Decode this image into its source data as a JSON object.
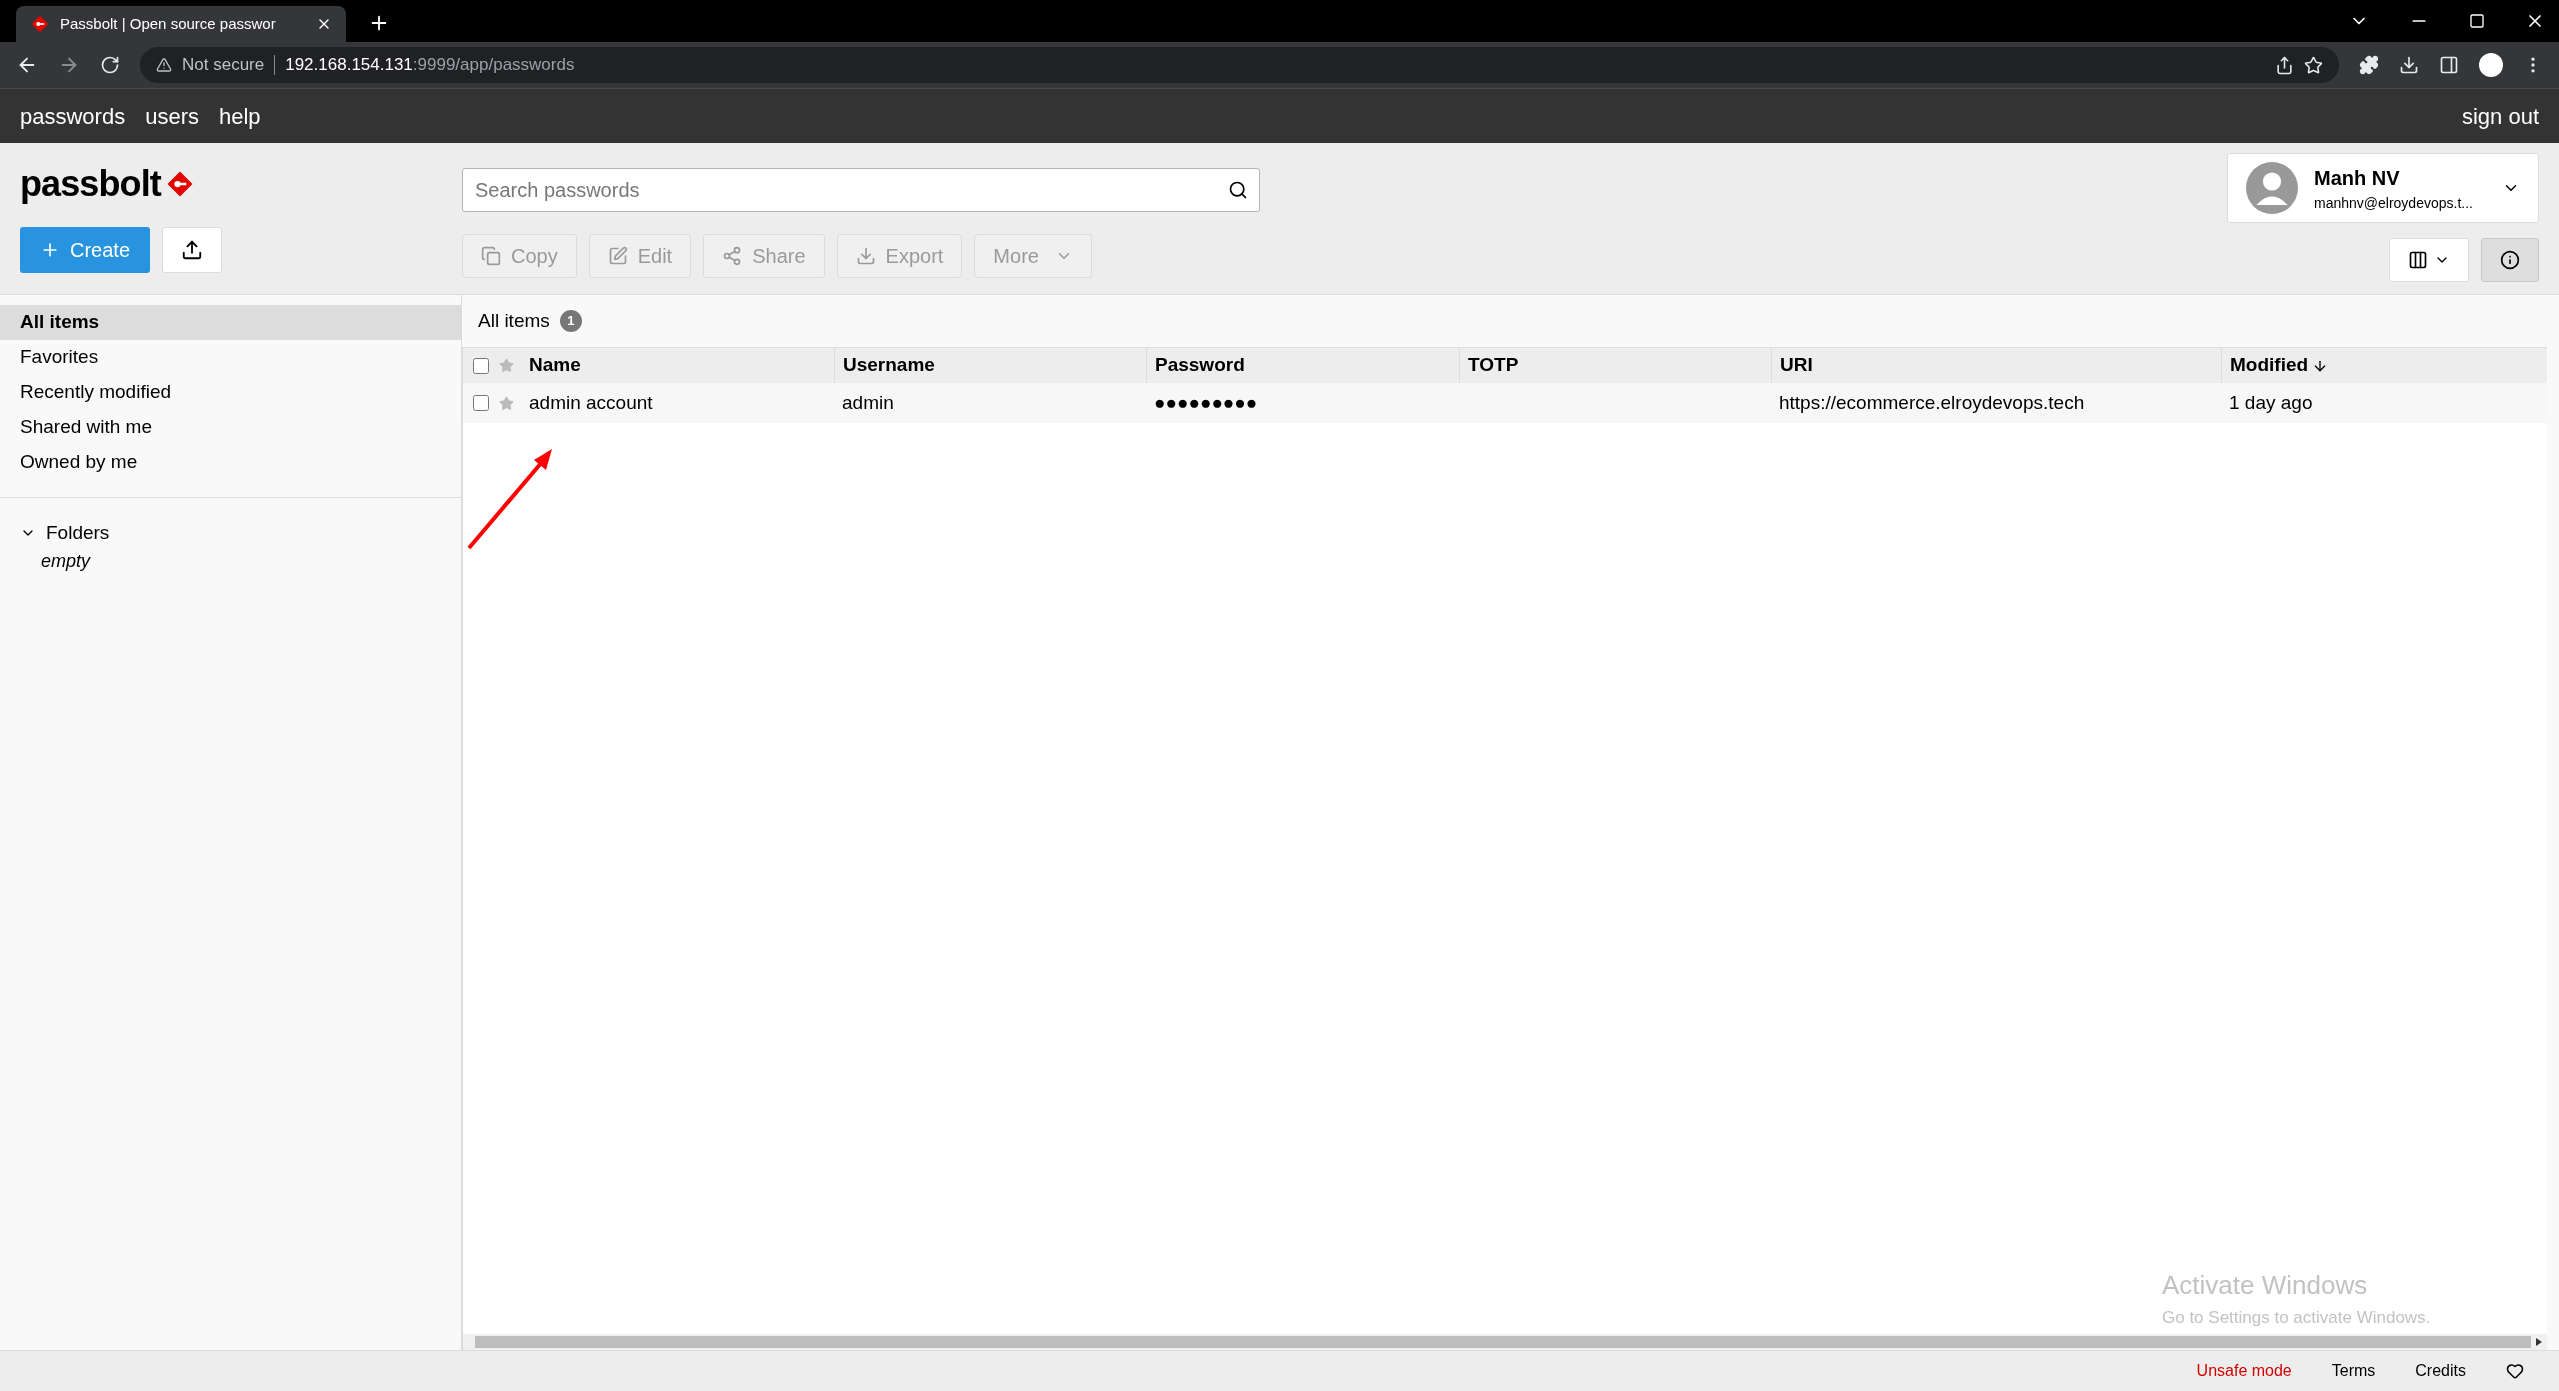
{
  "browser": {
    "tab_title": "Passbolt | Open source passwor",
    "security": "Not secure",
    "url_host": "192.168.154.131",
    "url_rest": ":9999/app/passwords"
  },
  "nav": {
    "items": [
      "passwords",
      "users",
      "help"
    ],
    "sign_out": "sign out"
  },
  "logo": "passbolt",
  "search": {
    "placeholder": "Search passwords"
  },
  "user": {
    "name": "Manh NV",
    "email": "manhnv@elroydevops.t..."
  },
  "create_button": "Create",
  "actions": [
    {
      "label": "Copy",
      "kind": "copy",
      "disabled": true
    },
    {
      "label": "Edit",
      "kind": "edit",
      "disabled": true
    },
    {
      "label": "Share",
      "kind": "share",
      "disabled": true
    },
    {
      "label": "Export",
      "kind": "export",
      "disabled": true
    },
    {
      "label": "More",
      "kind": "menu",
      "disabled": true
    }
  ],
  "sidebar": {
    "filters": [
      {
        "label": "All items",
        "selected": true
      },
      {
        "label": "Favorites",
        "selected": false
      },
      {
        "label": "Recently modified",
        "selected": false
      },
      {
        "label": "Shared with me",
        "selected": false
      },
      {
        "label": "Owned by me",
        "selected": false
      }
    ],
    "folders": {
      "label": "Folders",
      "expanded": true,
      "empty": "empty"
    }
  },
  "breadcrumb": {
    "label": "All items",
    "count": "1"
  },
  "table": {
    "all_checked": false,
    "columns": [
      {
        "label": "Name",
        "sorted": false
      },
      {
        "label": "Username",
        "sorted": false
      },
      {
        "label": "Password",
        "sorted": false
      },
      {
        "label": "TOTP",
        "sorted": false
      },
      {
        "label": "URI",
        "sorted": false
      },
      {
        "label": "Modified",
        "sorted": true
      }
    ],
    "rows": [
      {
        "checked": false,
        "favorite": false,
        "cells": [
          "admin account",
          "admin",
          "●●●●●●●●●",
          "",
          "https://ecommerce.elroydevops.tech",
          "1 day ago"
        ]
      }
    ]
  },
  "os_notice": {
    "title": "Activate Windows",
    "text": "Go to Settings to activate Windows."
  },
  "footer": [
    {
      "label": "Unsafe mode",
      "kind": "warning"
    },
    {
      "label": "Terms",
      "kind": "link"
    },
    {
      "label": "Credits",
      "kind": "link"
    }
  ]
}
